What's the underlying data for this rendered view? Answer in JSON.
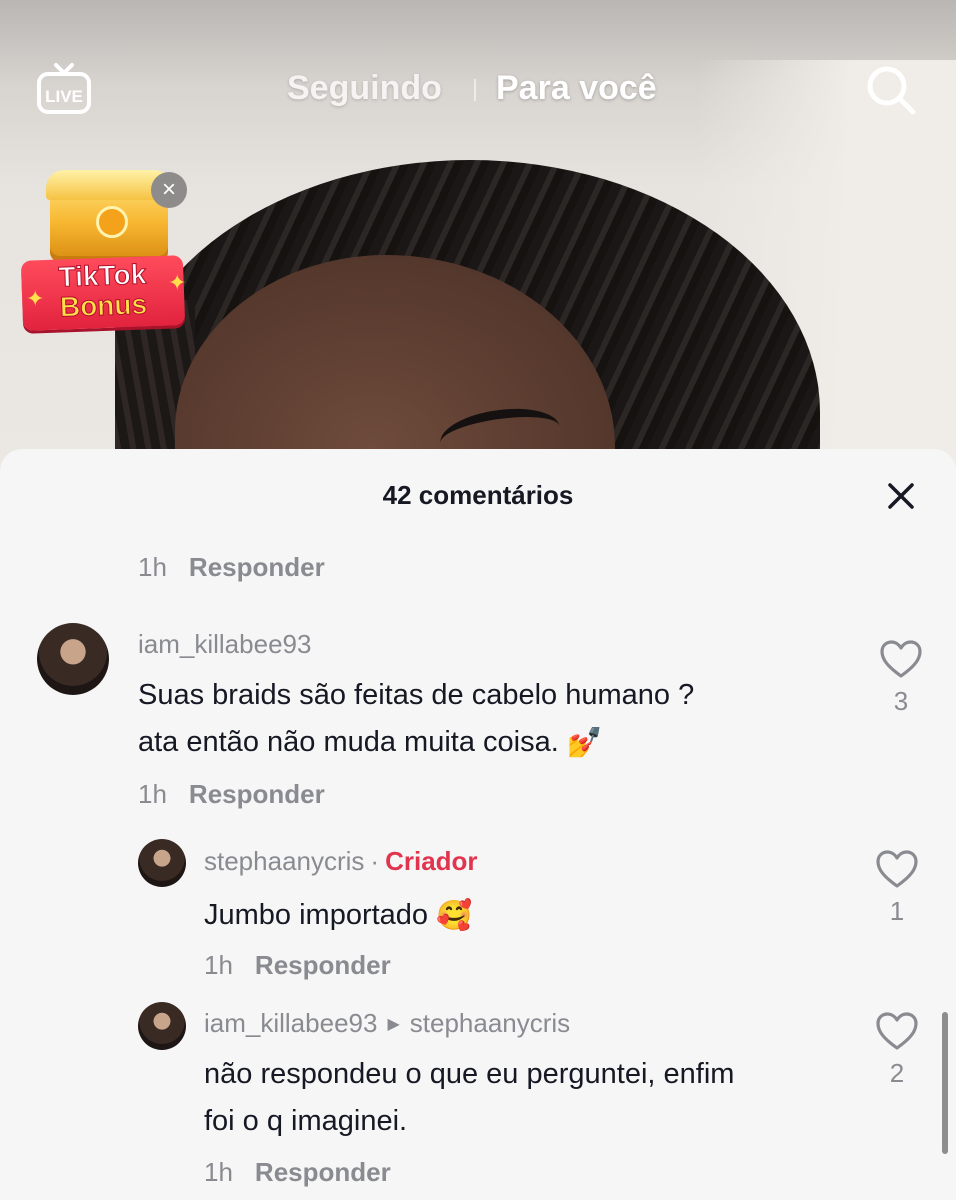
{
  "topnav": {
    "live_label": "LIVE",
    "tab_following": "Seguindo",
    "tab_foryou": "Para você"
  },
  "bonus": {
    "line1": "TikTok",
    "line2": "Bonus",
    "close_glyph": "×"
  },
  "comments_sheet": {
    "title": "42 comentários",
    "close_glyph": "✕",
    "prev_meta": {
      "time": "1h",
      "reply": "Responder"
    },
    "comments": [
      {
        "username": "iam_killabee93",
        "line1": "Suas braids são feitas de cabelo humano ?",
        "line2": "ata então não muda muita coisa.",
        "emoji": "💅",
        "time": "1h",
        "reply": "Responder",
        "likes": "3"
      },
      {
        "username": "stephaanycris",
        "dot": "·",
        "badge": "Criador",
        "line1": "Jumbo importado",
        "emoji": "🥰",
        "time": "1h",
        "reply": "Responder",
        "likes": "1"
      },
      {
        "username": "iam_killabee93",
        "arrow": "▶",
        "reply_to": "stephaanycris",
        "line1": "não respondeu o que eu perguntei, enfim",
        "line2": "foi o q imaginei.",
        "time": "1h",
        "reply": "Responder",
        "likes": "2"
      }
    ]
  },
  "colors": {
    "creator_badge": "#e1344f",
    "muted_text": "#8a8b91",
    "primary_text": "#161823",
    "sheet_bg": "#f6f6f6"
  },
  "icons": [
    "live-icon",
    "search-icon",
    "close-icon",
    "heart-icon",
    "treasure-chest-icon"
  ]
}
